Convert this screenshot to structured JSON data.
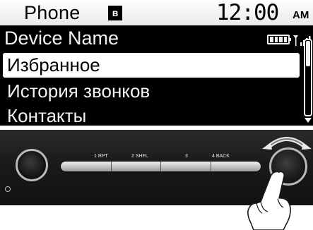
{
  "statusbar": {
    "title": "Phone",
    "bluetooth_glyph": "ʙ",
    "clock": "12:00",
    "ampm": "AM"
  },
  "devicebar": {
    "name": "Device Name",
    "battery_icon": "battery-full-icon",
    "signal_icon": "signal-strength-icon"
  },
  "menu": {
    "items": [
      {
        "label": "Избранное",
        "selected": true
      },
      {
        "label": "История звонков",
        "selected": false
      },
      {
        "label": "Контакты",
        "selected": false
      }
    ]
  },
  "controls": {
    "presets": [
      "1 RPT",
      "2 SHFL",
      "3",
      "4 BACK"
    ]
  },
  "colors": {
    "screen_bg": "#000000",
    "statusbar_bg": "#ffffff",
    "selection_bg": "#ffffff",
    "text_light": "#f2f2f2"
  }
}
